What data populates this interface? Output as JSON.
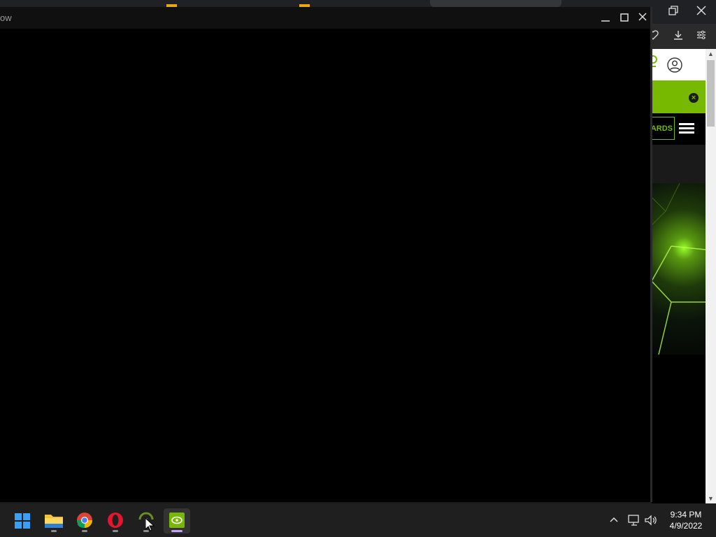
{
  "background_browser": {
    "nav_link_label": "ARDS",
    "promo_close_glyph": "×",
    "accent_color": "#76b900"
  },
  "game_window": {
    "title": "ow"
  },
  "taskbar": {
    "pinned": [
      {
        "name": "start",
        "icon": "windows-start-icon"
      },
      {
        "name": "file-explorer",
        "icon": "folder-icon"
      },
      {
        "name": "chrome",
        "icon": "chrome-icon"
      },
      {
        "name": "opera",
        "icon": "opera-icon"
      },
      {
        "name": "game-app",
        "icon": "game-app-icon"
      },
      {
        "name": "nvidia",
        "icon": "nvidia-icon"
      }
    ],
    "clock": {
      "time": "9:34 PM",
      "date": "4/9/2022"
    }
  }
}
